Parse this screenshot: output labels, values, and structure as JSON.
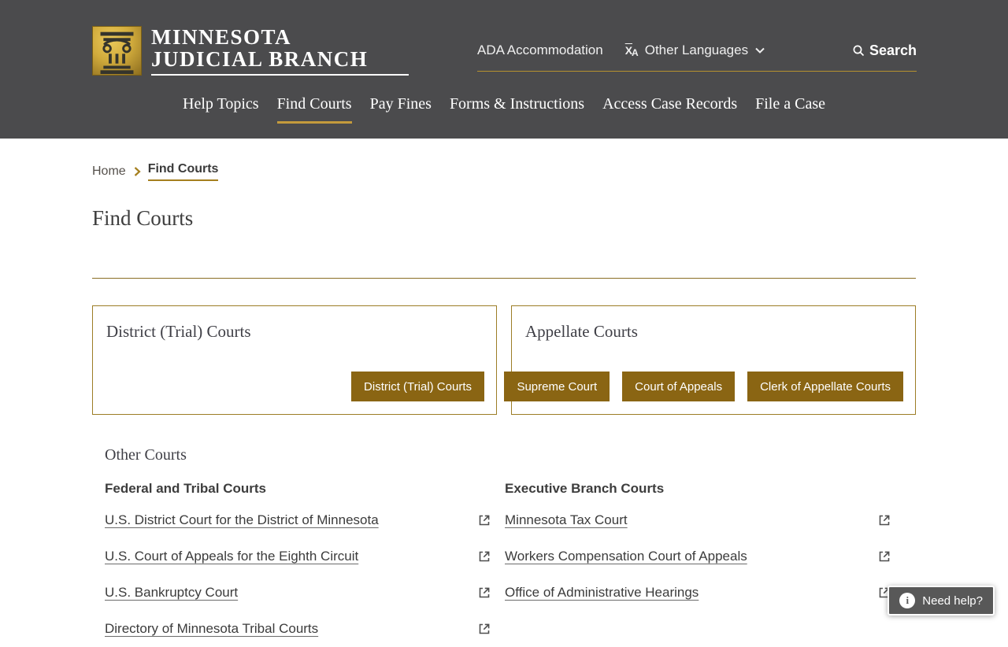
{
  "colors": {
    "header_bg": "#4b4b4d",
    "gold_accent": "#c49b3c",
    "gold_rule": "#8a6d24",
    "button_bg": "#8a6513",
    "card_border": "#9c7d26",
    "link_text": "#3b3b3b",
    "help_bg": "#585858"
  },
  "header": {
    "brand_line1": "MINNESOTA",
    "brand_line2": "JUDICIAL BRANCH",
    "utility": {
      "ada_label": "ADA Accommodation",
      "languages_label": "Other Languages",
      "search_label": "Search"
    },
    "nav": {
      "active_index": 1,
      "items": [
        {
          "label": "Help Topics"
        },
        {
          "label": "Find Courts"
        },
        {
          "label": "Pay Fines"
        },
        {
          "label": "Forms & Instructions"
        },
        {
          "label": "Access Case Records"
        },
        {
          "label": "File a Case"
        }
      ]
    }
  },
  "breadcrumb": {
    "home_label": "Home",
    "current_label": "Find Courts"
  },
  "page_title": "Find Courts",
  "court_cards": [
    {
      "title": "District (Trial) Courts",
      "buttons": [
        {
          "label": "District (Trial) Courts"
        }
      ]
    },
    {
      "title": "Appellate Courts",
      "buttons": [
        {
          "label": "Supreme Court"
        },
        {
          "label": "Court of Appeals"
        },
        {
          "label": "Clerk of Appellate Courts"
        }
      ]
    }
  ],
  "other_courts": {
    "heading": "Other Courts",
    "columns": [
      {
        "heading": "Federal and Tribal Courts",
        "links": [
          {
            "label": "U.S. District Court for the District of Minnesota"
          },
          {
            "label": "U.S. Court of Appeals for the Eighth Circuit"
          },
          {
            "label": "U.S. Bankruptcy Court"
          },
          {
            "label": "Directory of Minnesota Tribal Courts"
          }
        ]
      },
      {
        "heading": "Executive Branch Courts",
        "links": [
          {
            "label": "Minnesota Tax Court"
          },
          {
            "label": "Workers Compensation Court of Appeals"
          },
          {
            "label": "Office of Administrative Hearings"
          }
        ]
      }
    ]
  },
  "help_widget": {
    "label": "Need help?"
  },
  "icons": {
    "translate_x": "X",
    "translate_a": "A",
    "info_glyph": "i"
  }
}
